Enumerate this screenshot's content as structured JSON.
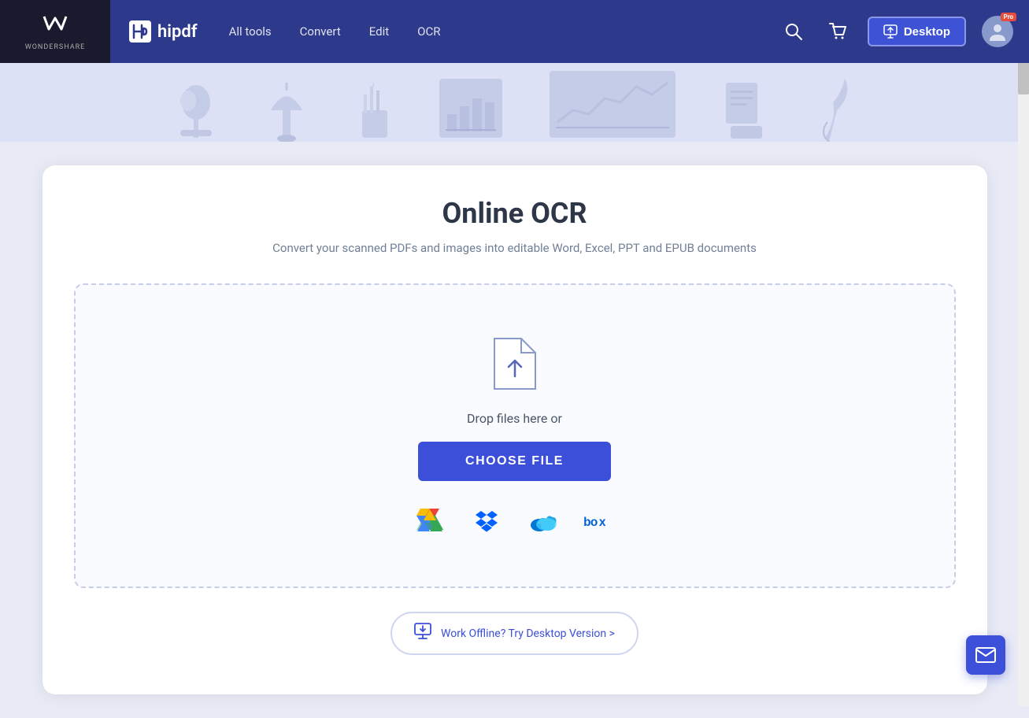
{
  "brand": {
    "wondershare": "wondershare",
    "ws_symbol": "❖",
    "hipdf": "hipdf",
    "hipdf_logo": "h"
  },
  "navbar": {
    "all_tools": "All tools",
    "convert": "Convert",
    "edit": "Edit",
    "ocr": "OCR",
    "desktop_btn": "Desktop",
    "pro_label": "Pro"
  },
  "hero": {
    "icons": [
      "🌱",
      "🔔",
      "✏️",
      "📊",
      "📈",
      "📄",
      "🖊️"
    ]
  },
  "page": {
    "title": "Online OCR",
    "subtitle": "Convert your scanned PDFs and images into editable Word, Excel, PPT and EPUB documents"
  },
  "dropzone": {
    "drop_text": "Drop files here or",
    "choose_file": "CHOOSE FILE"
  },
  "cloud_services": {
    "gdrive_label": "Google Drive",
    "dropbox_label": "Dropbox",
    "onedrive_label": "OneDrive",
    "box_label": "Box"
  },
  "offline": {
    "text": "Work Offline? Try Desktop Version >"
  },
  "colors": {
    "primary": "#3b4fd8",
    "nav_bg": "#2d3a8c",
    "body_bg": "#e8eaf6",
    "pro_red": "#e74c3c"
  }
}
